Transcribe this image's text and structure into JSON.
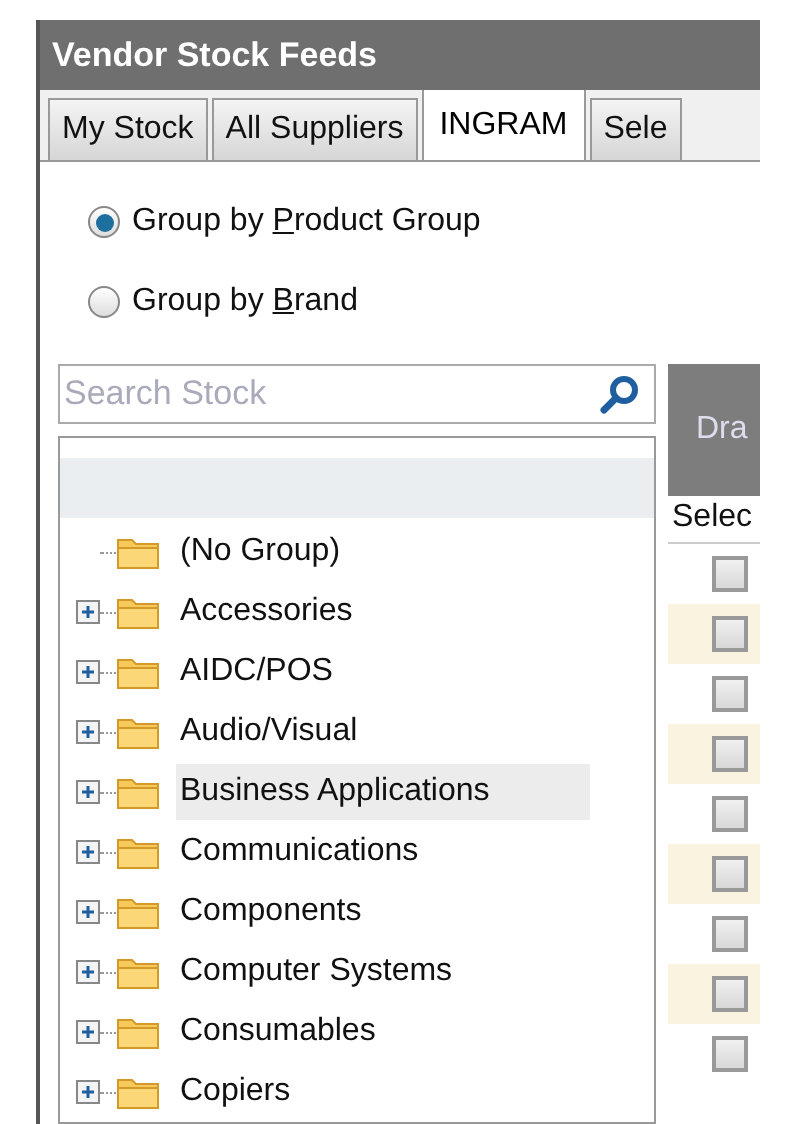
{
  "window": {
    "title": "Vendor Stock Feeds"
  },
  "tabs": [
    {
      "label": "My Stock",
      "selected": false
    },
    {
      "label": "All Suppliers",
      "selected": false
    },
    {
      "label": "INGRAM",
      "selected": true
    },
    {
      "label": "Sele",
      "selected": false
    }
  ],
  "group_options": [
    {
      "before": "Group by ",
      "key": "P",
      "after": "roduct Group",
      "selected": true
    },
    {
      "before": "Group by ",
      "key": "B",
      "after": "rand",
      "selected": false
    }
  ],
  "search": {
    "placeholder": "Search Stock"
  },
  "tree": [
    {
      "label": "(No Group)",
      "expandable": false,
      "selected": false
    },
    {
      "label": "Accessories",
      "expandable": true,
      "selected": false
    },
    {
      "label": "AIDC/POS",
      "expandable": true,
      "selected": false
    },
    {
      "label": "Audio/Visual",
      "expandable": true,
      "selected": false
    },
    {
      "label": "Business Applications",
      "expandable": true,
      "selected": true
    },
    {
      "label": "Communications",
      "expandable": true,
      "selected": false
    },
    {
      "label": "Components",
      "expandable": true,
      "selected": false
    },
    {
      "label": "Computer Systems",
      "expandable": true,
      "selected": false
    },
    {
      "label": "Consumables",
      "expandable": true,
      "selected": false
    },
    {
      "label": "Copiers",
      "expandable": true,
      "selected": false
    }
  ],
  "grid": {
    "header": "Dra",
    "column": "Selec",
    "rows": [
      {
        "checked": false
      },
      {
        "checked": false
      },
      {
        "checked": false
      },
      {
        "checked": false
      },
      {
        "checked": false
      },
      {
        "checked": false
      },
      {
        "checked": false
      },
      {
        "checked": false
      },
      {
        "checked": false
      }
    ]
  }
}
